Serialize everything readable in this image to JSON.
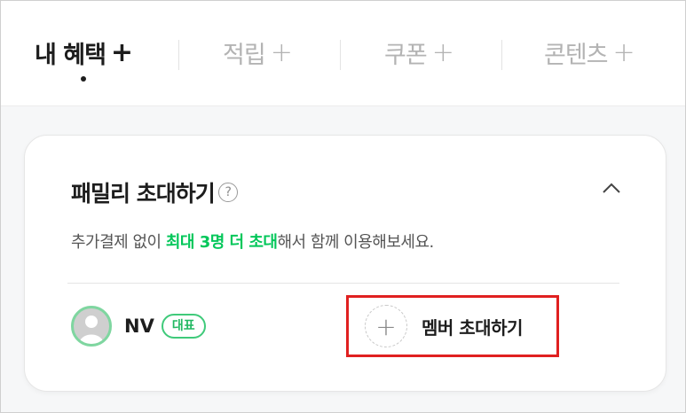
{
  "tabs": [
    {
      "label": "내 혜택",
      "plus": "+",
      "active": true
    },
    {
      "label": "적립",
      "plus": "+",
      "active": false
    },
    {
      "label": "쿠폰",
      "plus": "+",
      "active": false
    },
    {
      "label": "콘텐츠",
      "plus": "+",
      "active": false
    }
  ],
  "card": {
    "title": "패밀리 초대하기",
    "help_icon": "?",
    "desc_prefix": "추가결제 없이 ",
    "desc_highlight": "최대 3명 더 초대",
    "desc_suffix": "해서 함께 이용해보세요.",
    "member": {
      "name": "NV",
      "badge": "대표"
    },
    "invite": {
      "icon": "+",
      "label": "멤버 초대하기"
    }
  },
  "colors": {
    "accent": "#03c75a",
    "highlight_box": "#e02020"
  }
}
